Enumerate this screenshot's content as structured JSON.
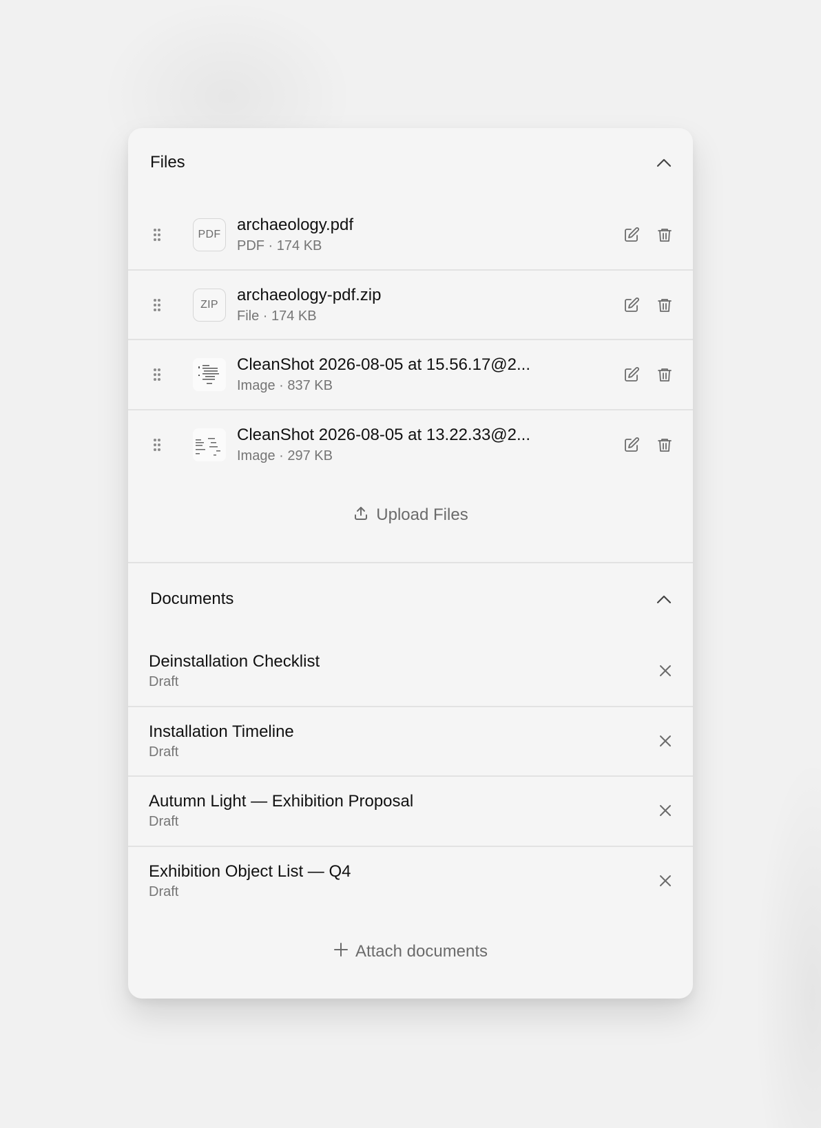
{
  "files_section": {
    "title": "Files",
    "items": [
      {
        "name": "archaeology.pdf",
        "meta": "PDF · 174 KB",
        "badge": "PDF"
      },
      {
        "name": "archaeology-pdf.zip",
        "meta": "File · 174 KB",
        "badge": "ZIP"
      },
      {
        "name": "CleanShot 2026-08-05 at 15.56.17@2...",
        "meta": "Image · 837 KB"
      },
      {
        "name": "CleanShot 2026-08-05 at 13.22.33@2...",
        "meta": "Image · 297 KB"
      }
    ],
    "upload_label": "Upload Files"
  },
  "documents_section": {
    "title": "Documents",
    "items": [
      {
        "title": "Deinstallation Checklist",
        "status": "Draft"
      },
      {
        "title": "Installation Timeline",
        "status": "Draft"
      },
      {
        "title": "Autumn Light — Exhibition Proposal",
        "status": "Draft"
      },
      {
        "title": "Exhibition Object List — Q4",
        "status": "Draft"
      }
    ],
    "attach_label": "Attach documents"
  },
  "colors": {
    "panel_bg": "#f5f5f5",
    "text_primary": "#111111",
    "text_secondary": "#757575",
    "divider": "#e2e2e2",
    "icon": "#6b6b6b"
  }
}
